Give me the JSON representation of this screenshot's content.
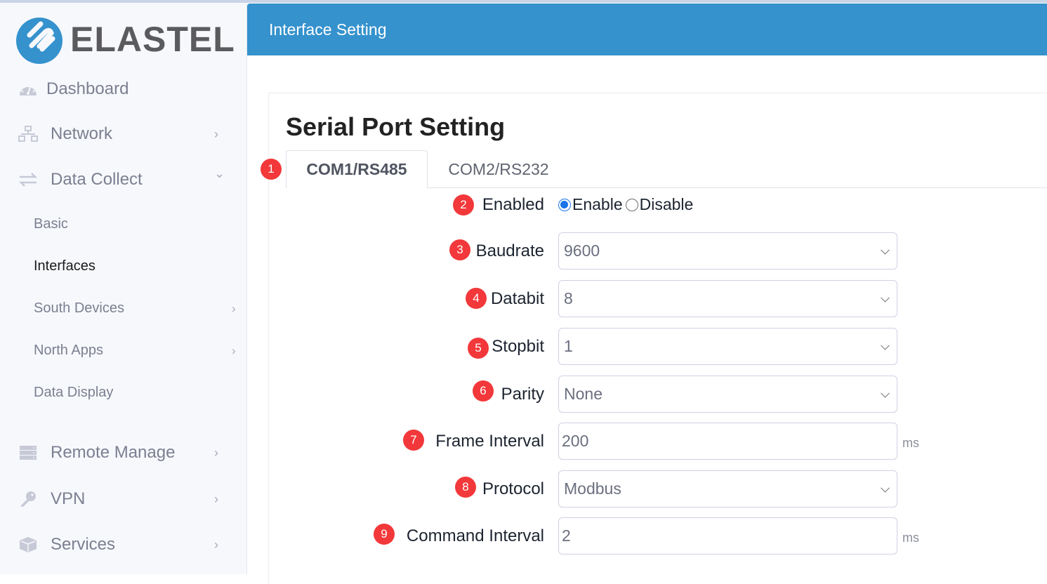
{
  "brand": {
    "name": "ELASTEL",
    "color": "#3592cd"
  },
  "sidebar": {
    "items": [
      {
        "label": "Dashboard",
        "icon": "dashboard-gauge-icon",
        "has_chevron": false
      },
      {
        "label": "Network",
        "icon": "network-icon",
        "has_chevron": true,
        "chevron": "›"
      },
      {
        "label": "Data Collect",
        "icon": "exchange-arrows-icon",
        "has_chevron": true,
        "chevron": "⌄",
        "expanded": true
      },
      {
        "label": "Remote Manage",
        "icon": "server-icon",
        "has_chevron": true,
        "chevron": "›"
      },
      {
        "label": "VPN",
        "icon": "key-icon",
        "has_chevron": true,
        "chevron": "›"
      },
      {
        "label": "Services",
        "icon": "cube-icon",
        "has_chevron": true,
        "chevron": "›"
      }
    ],
    "data_collect_children": [
      {
        "label": "Basic",
        "active": false,
        "has_chevron": false
      },
      {
        "label": "Interfaces",
        "active": true,
        "has_chevron": false
      },
      {
        "label": "South Devices",
        "active": false,
        "has_chevron": true,
        "chevron": "›"
      },
      {
        "label": "North Apps",
        "active": false,
        "has_chevron": true,
        "chevron": "›"
      },
      {
        "label": "Data Display",
        "active": false,
        "has_chevron": false
      }
    ]
  },
  "header": {
    "title": "Interface Setting",
    "color": "#3592cd"
  },
  "main": {
    "title": "Serial Port Setting",
    "tabs": [
      {
        "label": "COM1/RS485",
        "active": true,
        "badge": "1"
      },
      {
        "label": "COM2/RS232",
        "active": false
      }
    ],
    "enabled": {
      "badge": "2",
      "label": "Enabled",
      "options": [
        {
          "label": "Enable",
          "checked": true
        },
        {
          "label": "Disable",
          "checked": false
        }
      ]
    },
    "fields": [
      {
        "badge": "3",
        "label": "Baudrate",
        "value": "9600",
        "type": "select",
        "unit": ""
      },
      {
        "badge": "4",
        "label": "Databit",
        "value": "8",
        "type": "select",
        "unit": ""
      },
      {
        "badge": "5",
        "label": "Stopbit",
        "value": "1",
        "type": "select",
        "unit": ""
      },
      {
        "badge": "6",
        "label": "Parity",
        "value": "None",
        "type": "select",
        "unit": ""
      },
      {
        "badge": "7",
        "label": "Frame Interval",
        "value": "200",
        "type": "input",
        "unit": "ms"
      },
      {
        "badge": "8",
        "label": "Protocol",
        "value": "Modbus",
        "type": "select",
        "unit": ""
      },
      {
        "badge": "9",
        "label": "Command Interval",
        "value": "2",
        "type": "input",
        "unit": "ms"
      }
    ],
    "badge_color": "#f2383a"
  }
}
